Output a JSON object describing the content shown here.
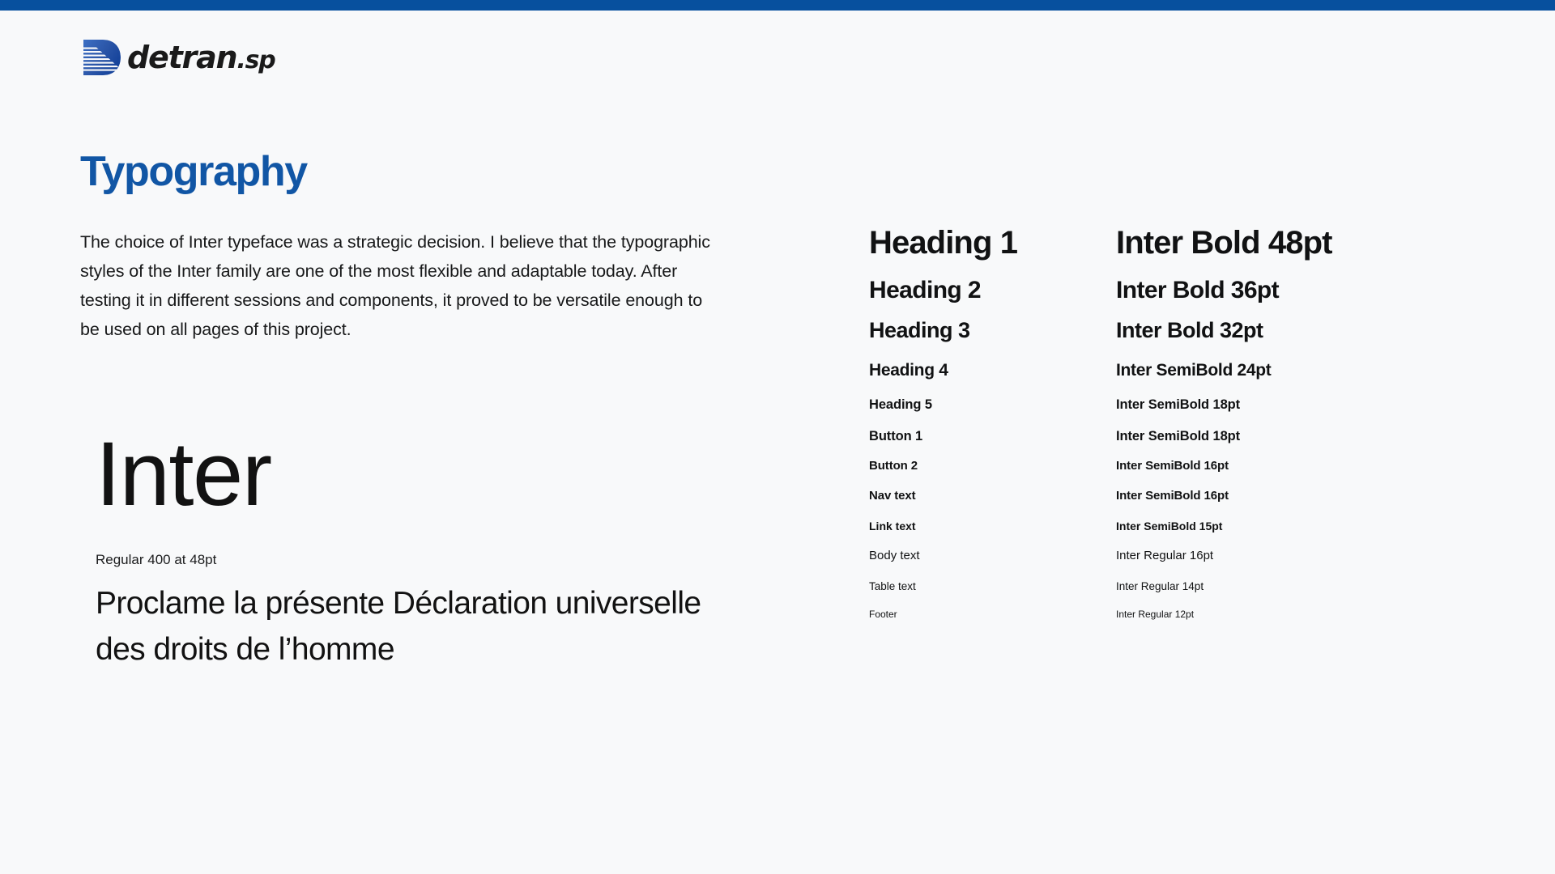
{
  "theme": {
    "page_background": "#F8F9FA",
    "accent_bar_color": "#07509E",
    "title_color": "#1156A5",
    "text_color": "#121212",
    "logo_blue": "#2B56A8"
  },
  "header": {
    "logo": {
      "mark_name": "detran-d-mark",
      "wordmark_primary": "detran",
      "wordmark_secondary": ".sp"
    }
  },
  "main": {
    "page_title": "Typography",
    "intro_paragraph": "The choice of Inter typeface was a strategic decision. I believe that the typographic styles of the Inter family are one of the most flexible and adaptable today. After testing it in different sessions and components, it proved to be versatile enough to be used on all pages of this project.",
    "specimen": {
      "word": "Inter",
      "caption": "Regular 400 at 48pt",
      "sample_text": "Proclame la présente Déclaration universelle des droits de l’homme"
    },
    "scale": {
      "rows": [
        {
          "name": "Heading 1",
          "spec": "Inter Bold 48pt"
        },
        {
          "name": "Heading 2",
          "spec": "Inter Bold 36pt"
        },
        {
          "name": "Heading 3",
          "spec": "Inter Bold 32pt"
        },
        {
          "name": "Heading 4",
          "spec": "Inter SemiBold 24pt"
        },
        {
          "name": "Heading 5",
          "spec": "Inter SemiBold 18pt"
        },
        {
          "name": "Button 1",
          "spec": "Inter SemiBold 18pt"
        },
        {
          "name": "Button 2",
          "spec": "Inter SemiBold 16pt"
        },
        {
          "name": "Nav text",
          "spec": "Inter SemiBold 16pt"
        },
        {
          "name": "Link text",
          "spec": "Inter SemiBold 15pt"
        },
        {
          "name": "Body text",
          "spec": "Inter Regular 16pt"
        },
        {
          "name": "Table text",
          "spec": "Inter Regular 14pt"
        },
        {
          "name": "Footer",
          "spec": "Inter Regular 12pt"
        }
      ]
    }
  }
}
